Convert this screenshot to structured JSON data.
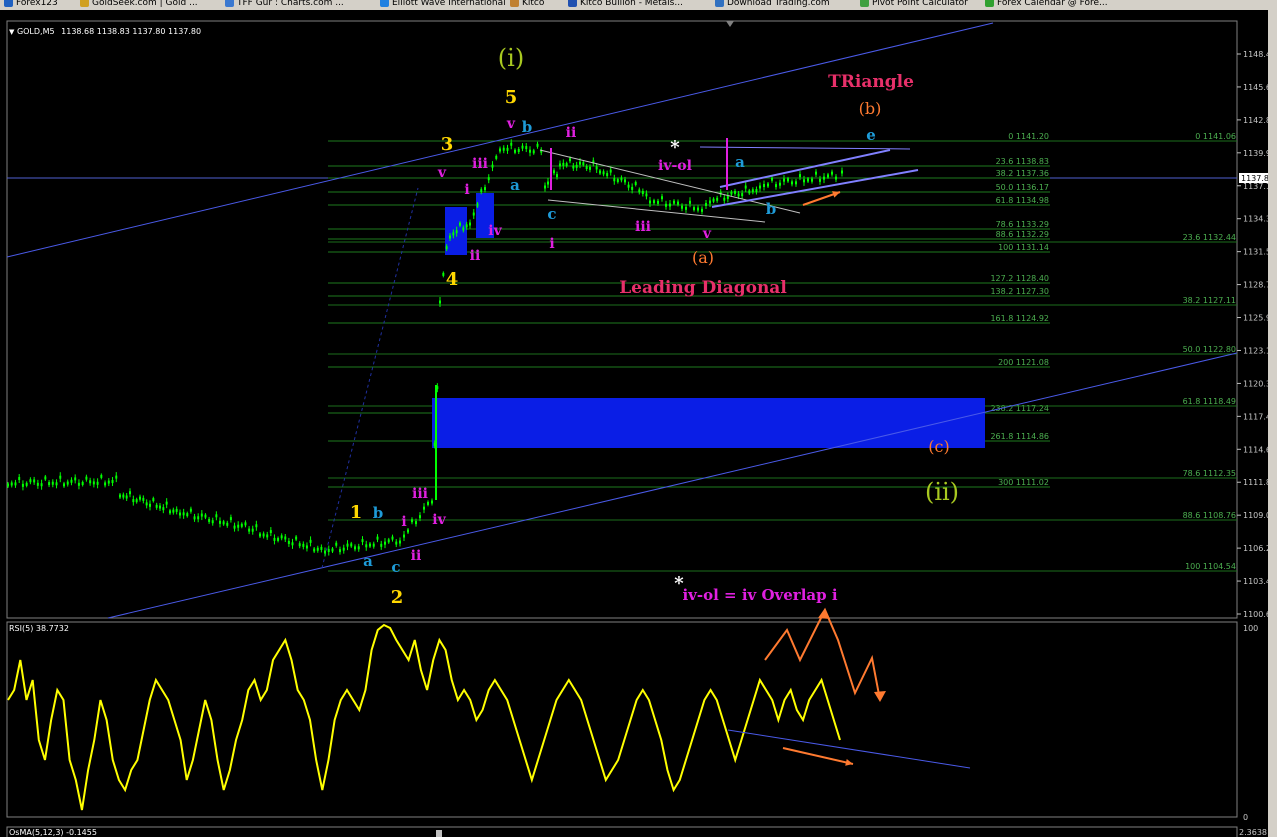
{
  "taskbar": {
    "items": [
      {
        "label": "Forex123",
        "icon": "chart-icon"
      },
      {
        "label": "GoldSeek.com | Gold ...",
        "icon": "gold-icon"
      },
      {
        "label": "TFF Gur : Charts.com ...",
        "icon": "page-icon"
      },
      {
        "label": "Elliott Wave International",
        "icon": "wave-icon"
      },
      {
        "label": "Kitco",
        "icon": "page-icon"
      },
      {
        "label": "Kitco Bullion - Metals...",
        "icon": "metals-icon"
      },
      {
        "label": "Download Trading.com",
        "icon": "download-icon"
      },
      {
        "label": "Pivot Point Calculator",
        "icon": "calc-icon"
      },
      {
        "label": "Forex Calendar @ Fore...",
        "icon": "calendar-icon"
      }
    ]
  },
  "main_header": {
    "symbol": "GOLD,M5",
    "ohlc": "1138.68 1138.83 1137.80 1137.80"
  },
  "rsi_header": "RSI(5) 38.7732",
  "osma_header": "OsMA(5,12,3) -0.1455",
  "price_axis": {
    "labels": [
      "1148.41",
      "1145.61",
      "1142.81",
      "1139.96",
      "1137.16",
      "1134.36",
      "1131.56",
      "1128.71",
      "1125.91",
      "1123.11",
      "1120.31",
      "1117.46",
      "1114.66",
      "1111.86",
      "1109.06",
      "1106.21",
      "1103.41",
      "1100.61"
    ],
    "current": "1137.80",
    "current_color": "#ffffff"
  },
  "rsi_axis": {
    "top": "100",
    "bottom": "0"
  },
  "osma_axis": "2.3638",
  "fib_left": [
    "0 1141.20",
    "23.6 1138.83",
    "38.2 1137.36",
    "50.0 1136.17",
    "61.8 1134.98",
    "78.6 1133.29",
    "88.6 1132.29",
    "100 1131.14",
    "127.2 1128.40",
    "138.2 1127.30",
    "161.8 1124.92",
    "200 1121.08",
    "238.2 1117.24",
    "261.8 1114.86",
    "300 1111.02"
  ],
  "fib_right": [
    "0 1141.06",
    "23.6 1132.44",
    "38.2 1127.11",
    "50.0 1122.80",
    "61.8 1118.49",
    "78.6 1112.35",
    "88.6 1108.76",
    "100 1104.54"
  ],
  "wave_labels": {
    "wave_i_big": "(i)",
    "wave_ii_big": "(ii)",
    "wave_1": "1",
    "wave_2": "2",
    "wave_3": "3",
    "wave_4": "4",
    "wave_5": "5",
    "b_left": "b",
    "a_left": "a",
    "c_left": "c",
    "i_left": "i",
    "ii_left": "ii",
    "iii_left": "iii",
    "iv_left": "iv",
    "v_3": "v",
    "i_3": "i",
    "iii_3": "iii",
    "iv_4": "iv",
    "ii_4": "ii",
    "v_5": "v",
    "b_5": "b",
    "a_5": "a",
    "c_5": "c",
    "i_ld": "i",
    "ii_ld": "ii",
    "iii_ld": "iii",
    "iv_ol": "iv-ol",
    "v_ld": "v",
    "a_paren": "(a)",
    "leading_diagonal": "Leading Diagonal",
    "a_tri": "a",
    "b_tri": "b",
    "e_tri": "e",
    "triangle": "TRiangle",
    "b_paren": "(b)",
    "c_paren": "(c)",
    "star": "*",
    "star2": "*",
    "note": "iv-ol = iv Overlap i"
  },
  "colors": {
    "candle": "#00ff00",
    "rsi": "#ffff00",
    "channel": "#4a5ae8",
    "fib": "#1e7a1e",
    "zone": "#0a1ee6",
    "orange": "#ff7a30",
    "magenta": "#e020e0",
    "cyan": "#1e9bd8",
    "yellow": "#ffd700",
    "olive": "#a8c820",
    "pink": "#e8306a"
  }
}
